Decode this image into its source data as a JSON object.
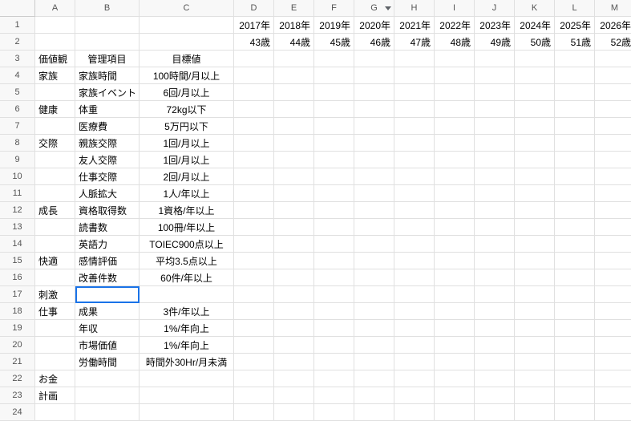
{
  "columns": [
    "A",
    "B",
    "C",
    "D",
    "E",
    "F",
    "G",
    "H",
    "I",
    "J",
    "K",
    "L",
    "M"
  ],
  "rowCount": 24,
  "filterColumn": "G",
  "selectedCell": "B17",
  "rows": {
    "1": {
      "D": "2017年",
      "E": "2018年",
      "F": "2019年",
      "G": "2020年",
      "H": "2021年",
      "I": "2022年",
      "J": "2023年",
      "K": "2024年",
      "L": "2025年",
      "M": "2026年"
    },
    "2": {
      "D": "43歳",
      "E": "44歳",
      "F": "45歳",
      "G": "46歳",
      "H": "47歳",
      "I": "48歳",
      "J": "49歳",
      "K": "50歳",
      "L": "51歳",
      "M": "52歳"
    },
    "3": {
      "A": "価値観",
      "B": "管理項目",
      "C": "目標値"
    },
    "4": {
      "A": "家族",
      "B": "家族時間",
      "C": "100時間/月以上"
    },
    "5": {
      "B": "家族イベント",
      "C": "6回/月以上"
    },
    "6": {
      "A": "健康",
      "B": "体重",
      "C": "72kg以下"
    },
    "7": {
      "B": "医療費",
      "C": "5万円以下"
    },
    "8": {
      "A": "交際",
      "B": "親族交際",
      "C": "1回/月以上"
    },
    "9": {
      "B": "友人交際",
      "C": "1回/月以上"
    },
    "10": {
      "B": "仕事交際",
      "C": "2回/月以上"
    },
    "11": {
      "B": "人脈拡大",
      "C": "1人/年以上"
    },
    "12": {
      "A": "成長",
      "B": "資格取得数",
      "C": "1資格/年以上"
    },
    "13": {
      "B": "読書数",
      "C": "100冊/年以上"
    },
    "14": {
      "B": "英語力",
      "C": "TOIEC900点以上"
    },
    "15": {
      "A": "快適",
      "B": "感情評価",
      "C": "平均3.5点以上"
    },
    "16": {
      "B": "改善件数",
      "C": "60件/年以上"
    },
    "17": {
      "A": "刺激"
    },
    "18": {
      "A": "仕事",
      "B": "成果",
      "C": "3件/年以上"
    },
    "19": {
      "B": "年収",
      "C": "1%/年向上"
    },
    "20": {
      "B": "市場価値",
      "C": "1%/年向上"
    },
    "21": {
      "B": "労働時間",
      "C": "時間外30Hr/月未満"
    },
    "22": {
      "A": "お金"
    },
    "23": {
      "A": "計画"
    }
  },
  "alignCenterCols": [
    "C"
  ],
  "alignRightCols": [
    "D",
    "E",
    "F",
    "G",
    "H",
    "I",
    "J",
    "K",
    "L",
    "M"
  ],
  "headerCenterRows": [
    "3"
  ]
}
